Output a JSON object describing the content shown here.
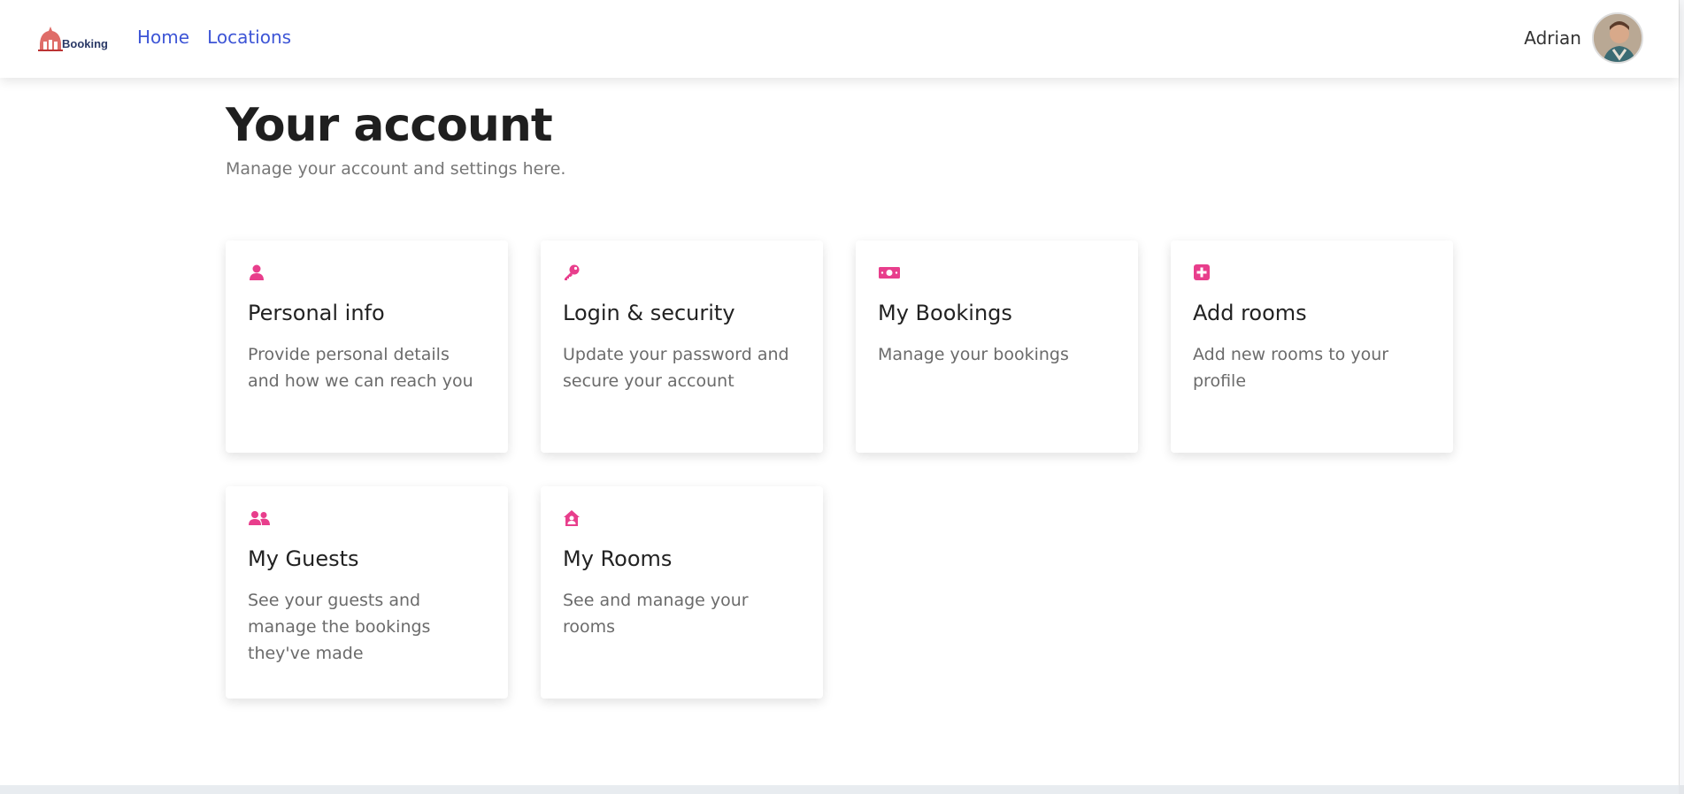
{
  "header": {
    "logo_text": "Booking",
    "nav": [
      "Home",
      "Locations"
    ],
    "user_name": "Adrian"
  },
  "page": {
    "title": "Your account",
    "subtitle": "Manage your account and settings here."
  },
  "cards": [
    {
      "icon": "user-icon",
      "title": "Personal info",
      "desc": "Provide personal details and how we can reach you"
    },
    {
      "icon": "key-icon",
      "title": "Login & security",
      "desc": "Update your password and secure your account"
    },
    {
      "icon": "money-icon",
      "title": "My Bookings",
      "desc": "Manage your bookings"
    },
    {
      "icon": "plus-square-icon",
      "title": "Add rooms",
      "desc": "Add new rooms to your profile"
    },
    {
      "icon": "users-icon",
      "title": "My Guests",
      "desc": "See your guests and manage the bookings they've made"
    },
    {
      "icon": "house-user-icon",
      "title": "My Rooms",
      "desc": "See and manage your rooms"
    }
  ],
  "colors": {
    "accent": "#e83e8c",
    "link": "#3d55d6"
  }
}
